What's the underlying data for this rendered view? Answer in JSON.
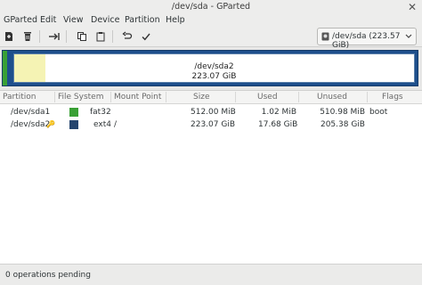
{
  "window": {
    "title": "/dev/sda - GParted"
  },
  "menu": [
    "GParted",
    "Edit",
    "View",
    "Device",
    "Partition",
    "Help"
  ],
  "toolbar": {
    "buttons": [
      "new-icon",
      "delete-icon",
      "resize-move-icon",
      "copy-icon",
      "paste-icon",
      "undo-icon",
      "apply-icon"
    ],
    "device_selector": "/dev/sda (223.57 GiB)"
  },
  "visual": {
    "label_line1": "/dev/sda2",
    "label_line2": "223.07 GiB",
    "used_fraction": 0.079,
    "colors": {
      "fat32": "#39a035",
      "ext4": "#1e4f8c",
      "used": "#f5f3b4"
    }
  },
  "table": {
    "headers": {
      "partition": "Partition",
      "filesystem": "File System",
      "mountpoint": "Mount Point",
      "size": "Size",
      "used": "Used",
      "unused": "Unused",
      "flags": "Flags"
    },
    "rows": [
      {
        "partition": "/dev/sda1",
        "key": "",
        "filesystem": "fat32",
        "fs_color": "#39a035",
        "mountpoint": "",
        "size": "512.00 MiB",
        "used": "1.02 MiB",
        "unused": "510.98 MiB",
        "flags": "boot"
      },
      {
        "partition": "/dev/sda2",
        "key": "🔑",
        "filesystem": "ext4",
        "fs_color": "#26456e",
        "mountpoint": "/",
        "size": "223.07 GiB",
        "used": "17.68 GiB",
        "unused": "205.38 GiB",
        "flags": ""
      }
    ]
  },
  "status": {
    "text": "0 operations pending"
  }
}
